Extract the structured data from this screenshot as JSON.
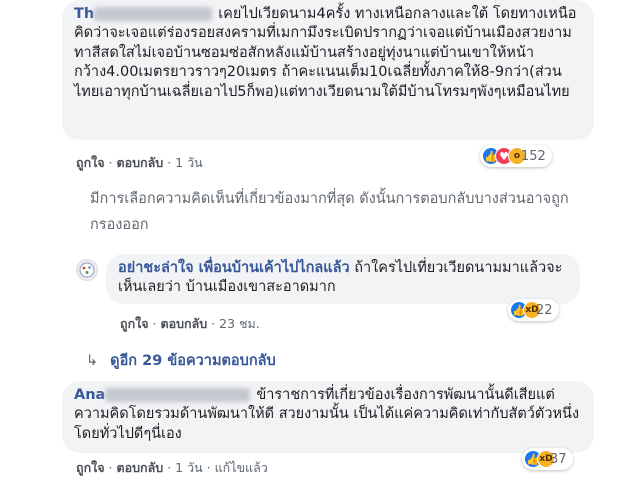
{
  "comment1": {
    "author": "Th",
    "text": "เคยไปเวียดนาม4ครั้ง ทางเหนือกลางและใต้ โดยทางเหนือคิดว่าจะเจอแต่ร่องรอยสงครามที่เมกามึงระเบิดปรากฏว่าเจอแต่บ้านเมืองสวยงามทาสีสดใสไม่เจอบ้านซอมซ่อสักหลังแม้บ้านสร้างอยู่ทุ่งนาแต่บ้านเขาให้หน้ากว้าง4.00เมตรยาวราวๆ20เมตร ถ้าคะแนนเต็ม10เฉลี่ยทั้งภาคให้8-9กว่า(ส่วนไทยเอาทุกบ้านเฉลี่ยเอาไป5ก็พอ)แต่ทางเวียดนามใต้มีบ้านโทรมๆพังๆเหมือนไทย",
    "like": "ถูกใจ",
    "reply": "ตอบกลับ",
    "time": "1 วัน",
    "reactions_count": "152",
    "reaction_icons": [
      "like-icon",
      "love-icon",
      "wow-icon"
    ]
  },
  "notice": "มีการเลือกความคิดเห็นที่เกี่ยวข้องมากที่สุด ดังนั้นการตอบกลับบางส่วนอาจถูกกรองออก",
  "reply1": {
    "author": "อย่าชะล่าใจ เพื่อนบ้านเค้าไปไกลแล้ว",
    "text": "ถ้าใครไปเที่ยวเวียดนามมาแล้วจะเห็นเลยว่า บ้านเมืองเขาสะอาดมาก",
    "like": "ถูกใจ",
    "reply": "ตอบกลับ",
    "time": "23 ชม.",
    "reactions_count": "22",
    "reaction_icons": [
      "like-icon",
      "haha-icon"
    ]
  },
  "more_replies": "ดูอีก 29 ข้อความตอบกลับ",
  "comment2": {
    "author": "Ana",
    "text": "ข้าราชการที่เกี่ยวข้องเรื่องการพัฒนานั้นดีเสียแต่ความคิดโดยรวมด้านพัฒนาให้ดี สวยงามนั้น เป็นได้แค่ความคิดเท่ากับสัตว์ตัวหนึ่ง โดยทั่วไปดีๆนี่เอง",
    "like": "ถูกใจ",
    "reply": "ตอบกลับ",
    "time": "1 วัน",
    "edited": "แก้ไขแล้ว",
    "reactions_count": "37",
    "reaction_icons": [
      "like-icon",
      "haha-icon"
    ]
  }
}
